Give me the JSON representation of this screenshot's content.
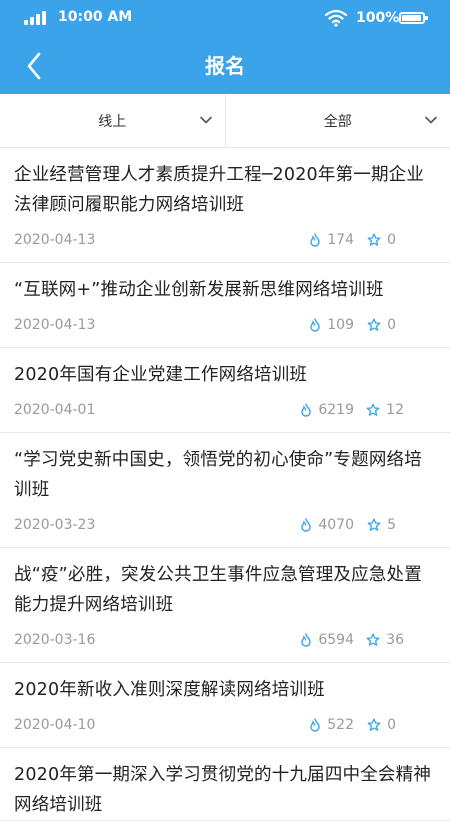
{
  "status": {
    "time": "10:00 AM",
    "battery": "100%"
  },
  "header": {
    "title": "报名"
  },
  "filters": [
    {
      "label": "线上"
    },
    {
      "label": "全部"
    }
  ],
  "items": [
    {
      "title": "企业经营管理人才素质提升工程─2020年第一期企业法律顾问履职能力网络培训班",
      "date": "2020-04-13",
      "views": "174",
      "favorites": "0"
    },
    {
      "title": "“互联网+”推动企业创新发展新思维网络培训班",
      "date": "2020-04-13",
      "views": "109",
      "favorites": "0"
    },
    {
      "title": "2020年国有企业党建工作网络培训班",
      "date": "2020-04-01",
      "views": "6219",
      "favorites": "12"
    },
    {
      "title": "“学习党史新中国史，领悟党的初心使命”专题网络培训班",
      "date": "2020-03-23",
      "views": "4070",
      "favorites": "5"
    },
    {
      "title": "战“疫”必胜，突发公共卫生事件应急管理及应急处置能力提升网络培训班",
      "date": "2020-03-16",
      "views": "6594",
      "favorites": "36"
    },
    {
      "title": "2020年新收入准则深度解读网络培训班",
      "date": "2020-04-10",
      "views": "522",
      "favorites": "0"
    },
    {
      "title": "2020年第一期深入学习贯彻党的十九届四中全会精神网络培训班",
      "date": "",
      "views": "",
      "favorites": ""
    }
  ],
  "colors": {
    "header": "#3aa3e9",
    "accent": "#3aa3e9",
    "meta": "#9a9a9a"
  },
  "icons": {
    "back": "back-arrow-icon",
    "views": "flame-icon",
    "favorites": "star-icon",
    "dropdown": "chevron-down-icon"
  }
}
